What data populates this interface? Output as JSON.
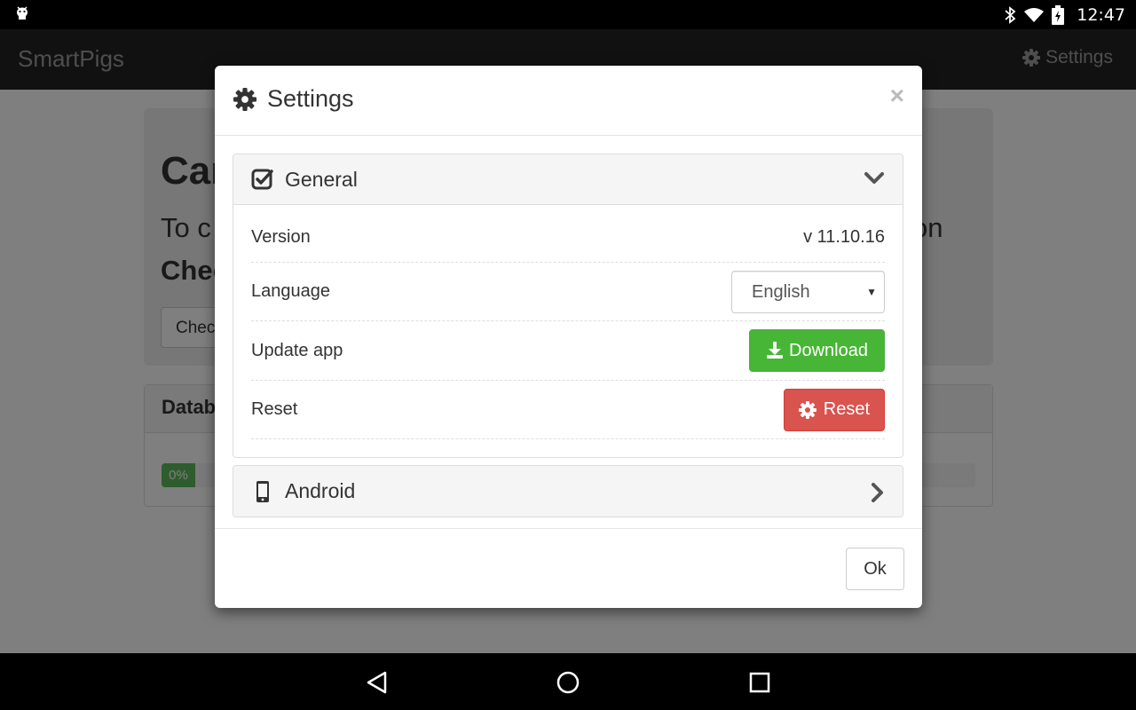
{
  "status_bar": {
    "time": "12:47"
  },
  "app": {
    "brand": "SmartPigs",
    "nav_settings_label": "Settings"
  },
  "background": {
    "jumbo_title": "Car",
    "jumbo_lead": "To c",
    "jumbo_lead_end": "on",
    "jumbo_bold": "Chec",
    "jumbo_button": "Chec",
    "db_heading": "Datab",
    "db_progress": "0%"
  },
  "modal": {
    "title": "Settings",
    "close": "×",
    "general": {
      "heading": "General",
      "rows": {
        "version_label": "Version",
        "version_value": "v 11.10.16",
        "language_label": "Language",
        "language_value": "English",
        "update_label": "Update app",
        "download_button": "Download",
        "reset_label": "Reset",
        "reset_button": "Reset"
      }
    },
    "android": {
      "heading": "Android"
    },
    "ok_button": "Ok"
  },
  "colors": {
    "navbar": "#222222",
    "success": "#47b535",
    "danger": "#d9534f",
    "progress": "#5cb85c"
  },
  "icons": {
    "notification": "android-icon",
    "bluetooth": "bluetooth-icon",
    "wifi": "wifi-icon",
    "battery": "battery-charging-icon",
    "settings": "gear-icon",
    "general": "check-square-icon",
    "android": "mobile-icon",
    "download": "download-icon",
    "back": "back-icon",
    "home": "home-icon",
    "recents": "recents-icon"
  }
}
